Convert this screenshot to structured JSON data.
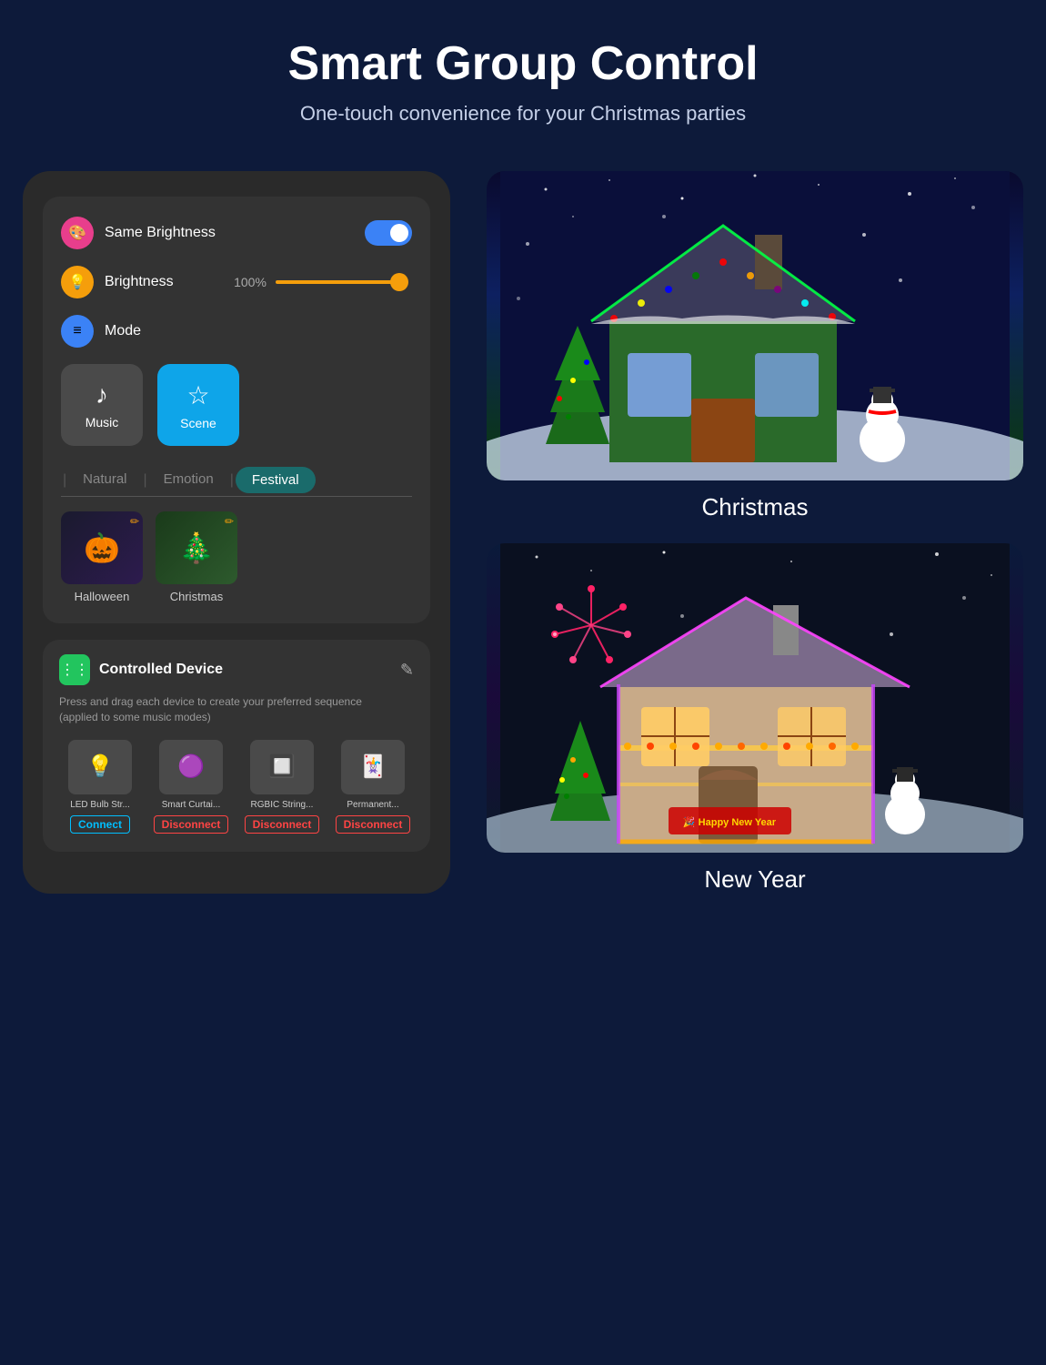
{
  "header": {
    "title": "Smart Group Control",
    "subtitle": "One-touch convenience for your Christmas parties"
  },
  "phone": {
    "same_brightness": {
      "label": "Same Brightness",
      "icon": "🎨",
      "enabled": true
    },
    "brightness": {
      "label": "Brightness",
      "value": "100%",
      "icon": "💡"
    },
    "mode": {
      "label": "Mode",
      "icon": "≡"
    },
    "mode_buttons": [
      {
        "id": "music",
        "label": "Music",
        "icon": "♪",
        "active": false
      },
      {
        "id": "scene",
        "label": "Scene",
        "icon": "☆",
        "active": true
      }
    ],
    "tabs": [
      {
        "label": "Natural",
        "active": false
      },
      {
        "label": "Emotion",
        "active": false
      },
      {
        "label": "Festival",
        "active": true
      }
    ],
    "festival_items": [
      {
        "name": "Halloween",
        "emoji": "🎃"
      },
      {
        "name": "Christmas",
        "emoji": "🎄"
      }
    ],
    "controlled_device": {
      "title": "Controlled Device",
      "subtitle": "Press and drag each device to create your preferred sequence\n(applied to some music modes)",
      "devices": [
        {
          "name": "LED Bulb Str...",
          "status": "Connect",
          "emoji": "💡"
        },
        {
          "name": "Smart Curtai...",
          "status": "Disconnect",
          "emoji": "🟣"
        },
        {
          "name": "RGBIC String...",
          "status": "Disconnect",
          "emoji": "🔲"
        },
        {
          "name": "Permanent...",
          "status": "Disconnect",
          "emoji": "🃏"
        }
      ]
    }
  },
  "scenes": [
    {
      "name": "Christmas",
      "theme": "christmas"
    },
    {
      "name": "New Year",
      "theme": "newyear"
    }
  ]
}
